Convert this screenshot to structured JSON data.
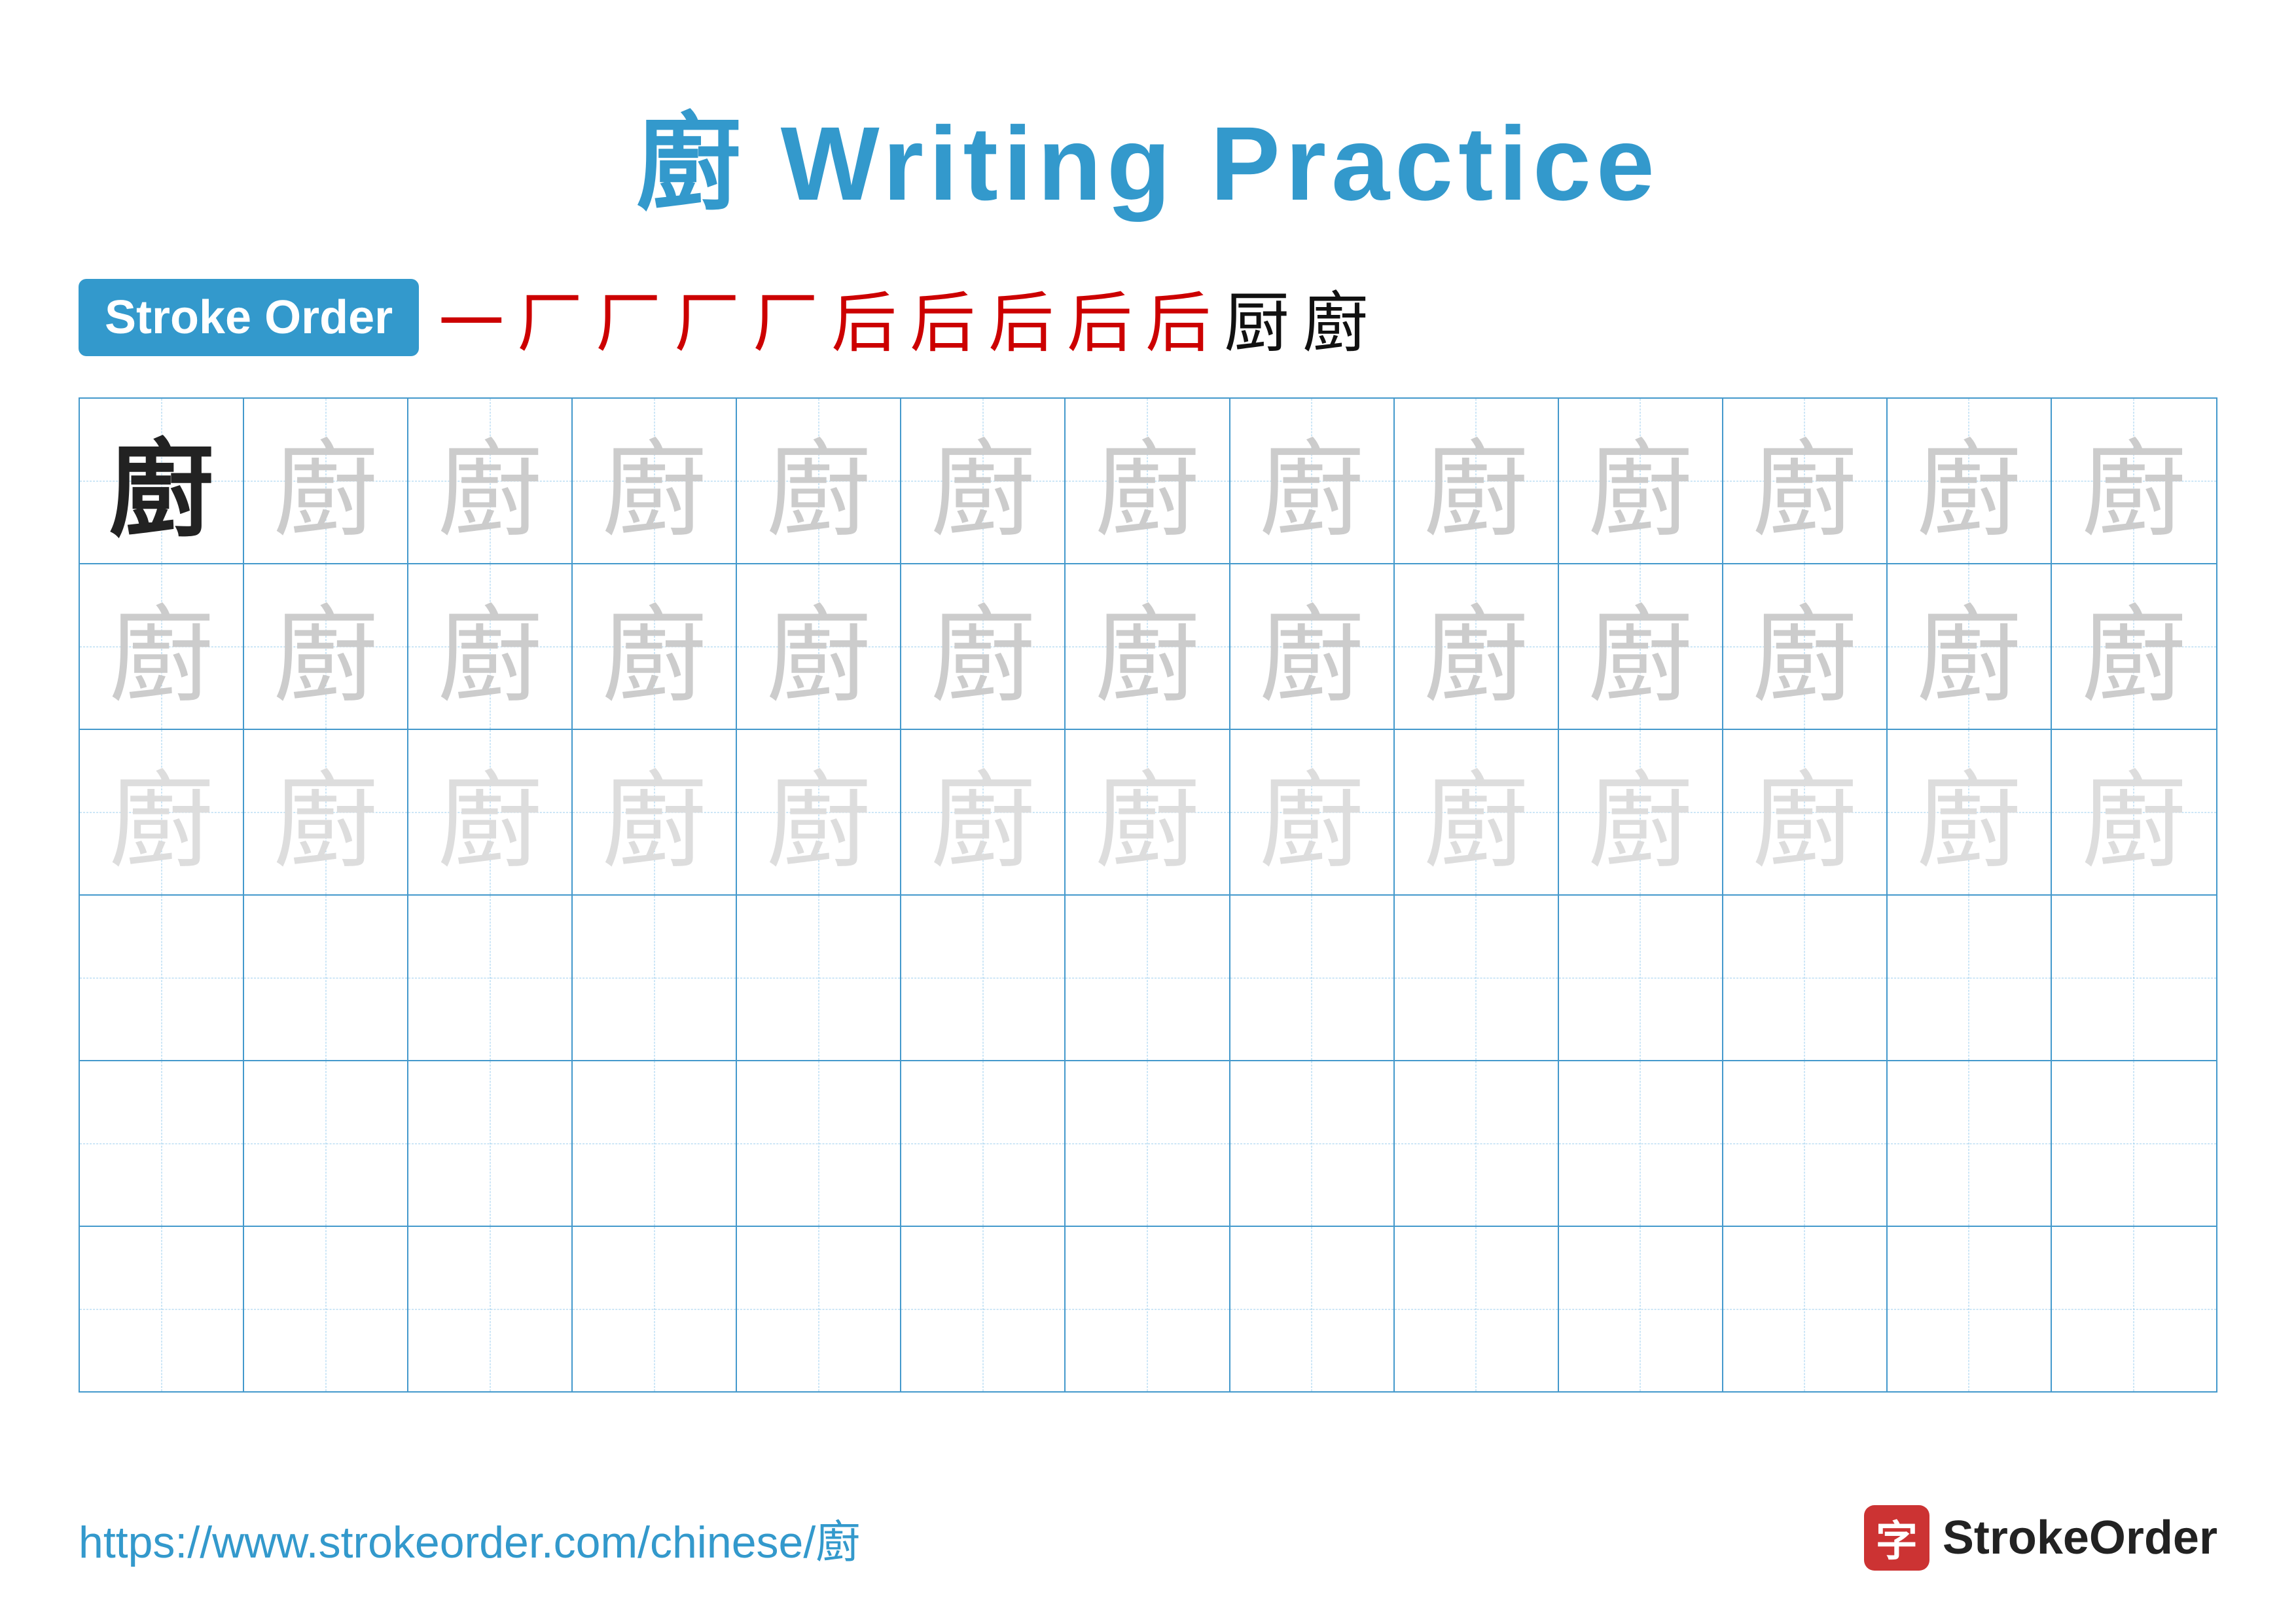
{
  "title": {
    "char": "廚",
    "text": " Writing Practice",
    "full": "廚 Writing Practice"
  },
  "stroke_order": {
    "badge_label": "Stroke Order",
    "strokes": [
      "一",
      "厂",
      "厂",
      "厂",
      "厂",
      "后",
      "后",
      "后",
      "后",
      "后",
      "厨",
      "廚"
    ]
  },
  "grid": {
    "rows": 6,
    "cols": 13,
    "character": "廚",
    "row_types": [
      "solid_then_ghost_dark",
      "ghost_dark",
      "ghost_light",
      "empty",
      "empty",
      "empty"
    ]
  },
  "footer": {
    "url": "https://www.strokeorder.com/chinese/廚",
    "logo_char": "字",
    "logo_text": "StrokeOrder"
  }
}
